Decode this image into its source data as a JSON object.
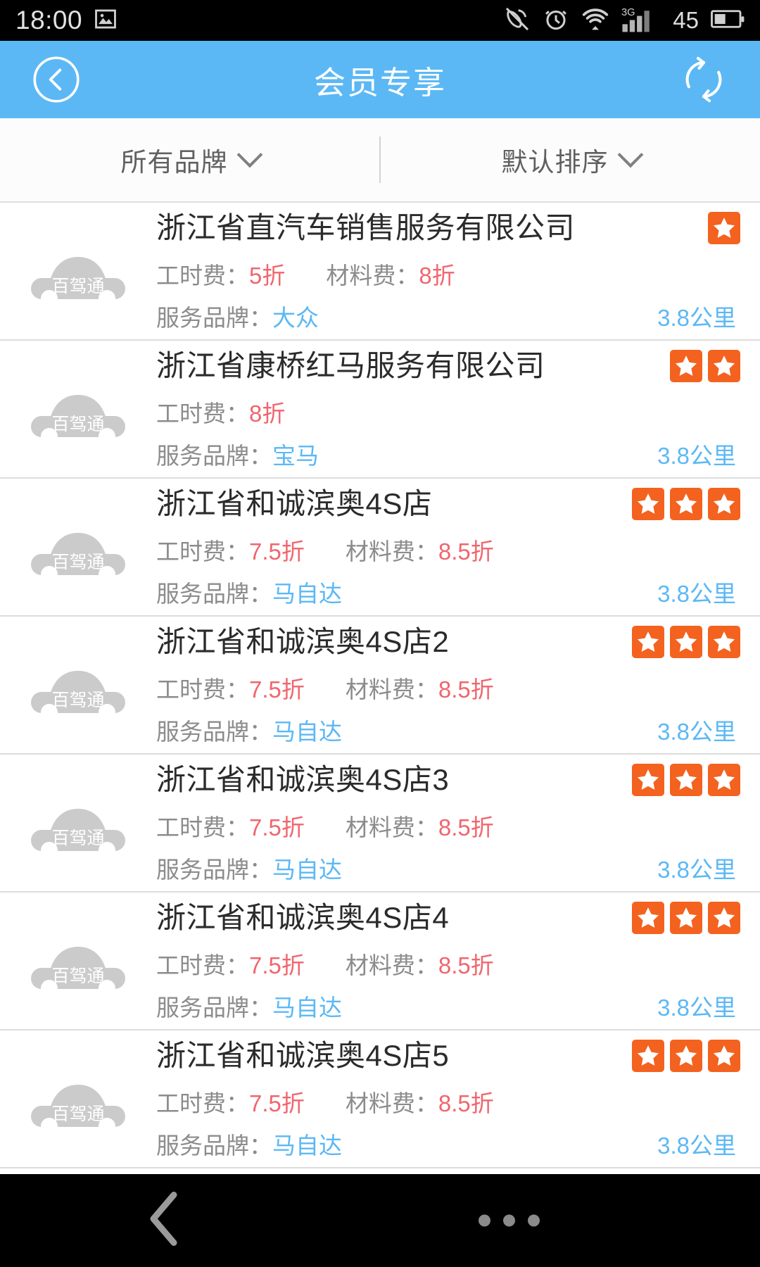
{
  "status_bar": {
    "time": "18:00",
    "battery_percent": "45",
    "network_type": "3G",
    "icons": [
      "image-icon",
      "mute-call-icon",
      "alarm-icon",
      "wifi-icon",
      "signal-icon",
      "battery-icon"
    ]
  },
  "header": {
    "title": "会员专享",
    "back_icon": "circle-back-arrow-icon",
    "refresh_icon": "refresh-icon"
  },
  "filter_bar": {
    "brand_filter": "所有品牌",
    "sort_filter": "默认排序",
    "chevron_icon": "chevron-down-icon"
  },
  "colors": {
    "header_blue": "#5cb8f5",
    "star_orange": "#f4621f",
    "discount_red": "#f0666e",
    "link_blue": "#5cb8f5",
    "label_gray": "#8c8c8c",
    "title_dark": "#2b2b2b"
  },
  "labels": {
    "labor_fee": "工时费：",
    "material_fee": "材料费：",
    "service_brand": "服务品牌：",
    "thumb_watermark": "百驾通"
  },
  "list": {
    "items": [
      {
        "name": "浙江省直汽车销售服务有限公司",
        "stars": 1,
        "labor_fee": "5折",
        "material_fee": "8折",
        "brand": "大众",
        "distance": "3.8公里"
      },
      {
        "name": "浙江省康桥红马服务有限公司",
        "stars": 2,
        "labor_fee": "8折",
        "material_fee": "",
        "brand": "宝马",
        "distance": "3.8公里"
      },
      {
        "name": "浙江省和诚滨奥4S店",
        "stars": 3,
        "labor_fee": "7.5折",
        "material_fee": "8.5折",
        "brand": "马自达",
        "distance": "3.8公里"
      },
      {
        "name": "浙江省和诚滨奥4S店2",
        "stars": 3,
        "labor_fee": "7.5折",
        "material_fee": "8.5折",
        "brand": "马自达",
        "distance": "3.8公里"
      },
      {
        "name": "浙江省和诚滨奥4S店3",
        "stars": 3,
        "labor_fee": "7.5折",
        "material_fee": "8.5折",
        "brand": "马自达",
        "distance": "3.8公里"
      },
      {
        "name": "浙江省和诚滨奥4S店4",
        "stars": 3,
        "labor_fee": "7.5折",
        "material_fee": "8.5折",
        "brand": "马自达",
        "distance": "3.8公里"
      },
      {
        "name": "浙江省和诚滨奥4S店5",
        "stars": 3,
        "labor_fee": "7.5折",
        "material_fee": "8.5折",
        "brand": "马自达",
        "distance": "3.8公里"
      }
    ]
  },
  "nav_bar": {
    "back_icon": "back-chevron-icon",
    "menu_icon": "overflow-dots-icon"
  }
}
